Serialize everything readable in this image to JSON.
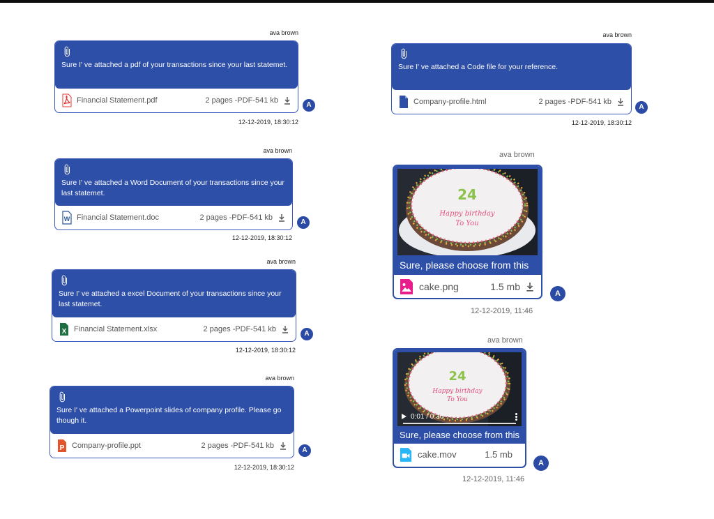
{
  "messages": [
    {
      "sender": "ava brown",
      "text": "Sure I' ve attached a pdf of your transactions since your last statemet.",
      "file": "Financial Statement.pdf",
      "meta": "2 pages -PDF-541 kb",
      "time": "12-12-2019, 18:30:12",
      "avatar": "A",
      "icon": "pdf-file-icon"
    },
    {
      "sender": "ava brown",
      "text": "Sure I' ve attached a Word Document of your transactions since your last statemet.",
      "file": "Financial Statement.doc",
      "meta": "2 pages -PDF-541 kb",
      "time": "12-12-2019, 18:30:12",
      "avatar": "A",
      "icon": "word-file-icon"
    },
    {
      "sender": "ava brown",
      "text": "Sure I' ve attached a excel Document of your transactions since your last statemet.",
      "file": "Financial Statement.xlsx",
      "meta": "2 pages -PDF-541 kb",
      "time": "12-12-2019, 18:30:12",
      "avatar": "A",
      "icon": "excel-file-icon"
    },
    {
      "sender": "ava brown",
      "text": "Sure I' ve attached a Powerpoint slides of company profile. Please go though it.",
      "file": "Company-profile.ppt",
      "meta": "2 pages -PDF-541 kb",
      "time": "12-12-2019, 18:30:12",
      "avatar": "A",
      "icon": "powerpoint-file-icon"
    },
    {
      "sender": "ava brown",
      "text": "Sure I' ve attached a Code file for your reference.",
      "file": "Company-profile.html",
      "meta": "2 pages -PDF-541 kb",
      "time": "12-12-2019, 18:30:12",
      "avatar": "A",
      "icon": "code-file-icon"
    }
  ],
  "media": [
    {
      "sender": "ava brown",
      "caption": "Sure,  please choose from this",
      "file": "cake.png",
      "size": "1.5 mb",
      "time": "12-12-2019, 11:46",
      "avatar": "A",
      "icon": "image-file-icon",
      "cake_text": [
        "Happy birthday",
        "To You"
      ]
    },
    {
      "sender": "ava brown",
      "caption": "Sure,  please choose from this",
      "file": "cake.mov",
      "size": "1.5 mb",
      "time": "12-12-2019, 11:46",
      "avatar": "A",
      "icon": "video-file-icon",
      "video_time": "0:01 / 0:30",
      "cake_text": [
        "Happy birthday",
        "To You"
      ]
    }
  ],
  "colors": {
    "primary": "#2e4fa8",
    "pdf": "#e53935",
    "word": "#2b579a",
    "excel": "#1d6f42",
    "ppt": "#e0552b",
    "image": "#e91e8c",
    "video": "#29b6f6"
  }
}
